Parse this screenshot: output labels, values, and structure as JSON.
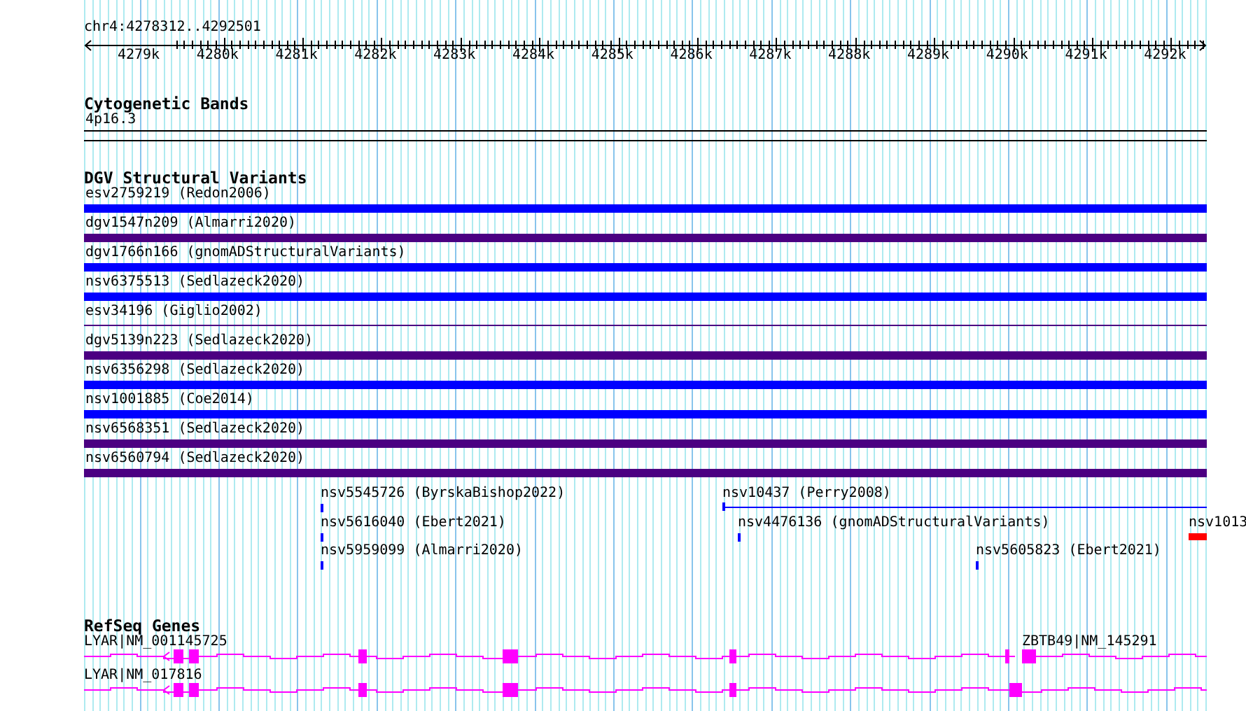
{
  "ruler": {
    "location": "chr4:4278312..4292501",
    "ticks": [
      "4279k",
      "4280k",
      "4281k",
      "4282k",
      "4283k",
      "4284k",
      "4285k",
      "4286k",
      "4287k",
      "4288k",
      "4289k",
      "4290k",
      "4291k",
      "4292k"
    ]
  },
  "cytogenetic_bands": {
    "title": "Cytogenetic Bands",
    "band": "4p16.3"
  },
  "dgv": {
    "title": "DGV Structural Variants",
    "rows": [
      {
        "label": "esv2759219 (Redon2006)",
        "color": "#0000ff",
        "kind": "bar"
      },
      {
        "label": "dgv1547n209 (Almarri2020)",
        "color": "#4b0082",
        "kind": "bar"
      },
      {
        "label": "dgv1766n166 (gnomADStructuralVariants)",
        "color": "#0000ff",
        "kind": "bar"
      },
      {
        "label": "nsv6375513 (Sedlazeck2020)",
        "color": "#0000ff",
        "kind": "bar"
      },
      {
        "label": "esv34196 (Giglio2002)",
        "color": "#4b0082",
        "kind": "line"
      },
      {
        "label": "dgv5139n223 (Sedlazeck2020)",
        "color": "#4b0082",
        "kind": "bar"
      },
      {
        "label": "nsv6356298 (Sedlazeck2020)",
        "color": "#0000ff",
        "kind": "bar"
      },
      {
        "label": "nsv1001885 (Coe2014)",
        "color": "#0000ff",
        "kind": "bar"
      },
      {
        "label": "nsv6568351 (Sedlazeck2020)",
        "color": "#4b0082",
        "kind": "bar"
      },
      {
        "label": "nsv6560794 (Sedlazeck2020)",
        "color": "#4b0082",
        "kind": "bar"
      }
    ],
    "features": [
      {
        "label": "nsv5545726 (ByrskaBishop2022)",
        "color": "#0000ff"
      },
      {
        "label": "nsv10437 (Perry2008)",
        "color": "#0000ff"
      },
      {
        "label": "nsv5616040 (Ebert2021)",
        "color": "#0000ff"
      },
      {
        "label": "nsv4476136 (gnomADStructuralVariants)",
        "color": "#0000ff"
      },
      {
        "label": "nsv1013",
        "color": "#ff0000"
      },
      {
        "label": "nsv5959099 (Almarri2020)",
        "color": "#0000ff"
      },
      {
        "label": "nsv5605823 (Ebert2021)",
        "color": "#0000ff"
      }
    ]
  },
  "refseq": {
    "title": "RefSeq Genes",
    "genes": [
      {
        "label": "LYAR|NM_001145725"
      },
      {
        "label": "ZBTB49|NM_145291"
      },
      {
        "label": "LYAR|NM_017816"
      }
    ]
  }
}
